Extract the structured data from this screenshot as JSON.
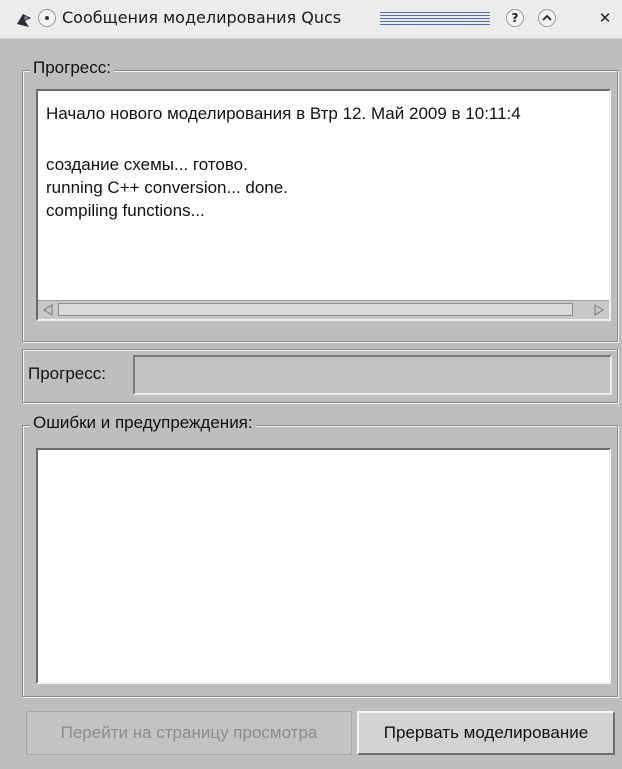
{
  "window": {
    "title": "Сообщения моделирования Qucs",
    "help_glyph": "?",
    "shade_glyph": "^",
    "close_glyph": "✕"
  },
  "progress_group": {
    "label": "Прогресс:",
    "log_lines": [
      "Начало нового моделирования в Втр 12. Май 2009 в 10:11:4",
      "",
      "создание схемы... готово.",
      "running C++ conversion... done.",
      "compiling functions..."
    ]
  },
  "progress_bar": {
    "label": "Прогресс:",
    "value": 0
  },
  "errors_group": {
    "label": "Ошибки и предупреждения:",
    "content": ""
  },
  "buttons": {
    "goto_display": "Перейти на страницу просмотра",
    "abort": "Прервать моделирование"
  },
  "icons": {
    "app": "qucs-app-icon",
    "menu": "window-menu-icon",
    "help": "help-icon",
    "shade": "shade-icon",
    "close": "close-icon"
  }
}
